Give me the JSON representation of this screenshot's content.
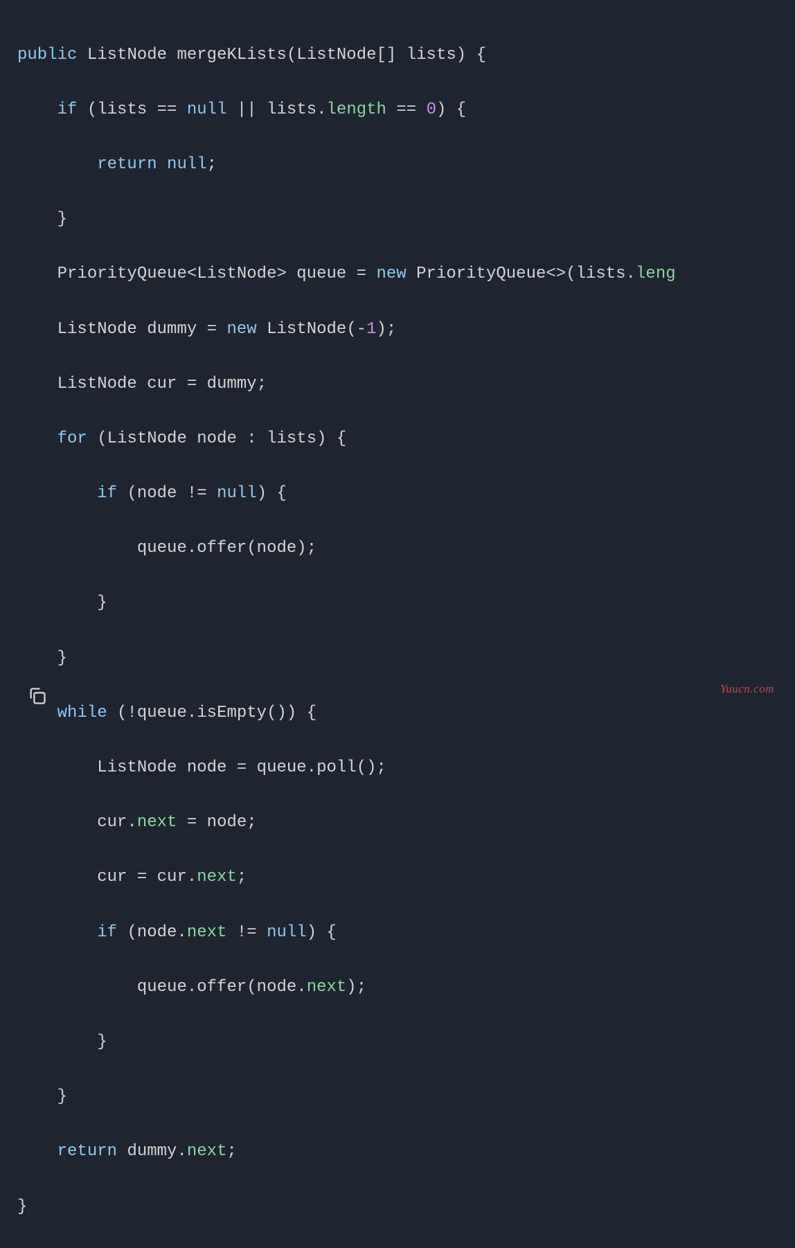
{
  "code": {
    "line1": {
      "kw_public": "public",
      "type1": "ListNode",
      "method": "mergeKLists",
      "paren_open": "(",
      "type2": "ListNode",
      "brackets": "[]",
      "param": "lists",
      "paren_close": ")",
      "brace_open": "{"
    },
    "line2": {
      "kw_if": "if",
      "paren_open": "(",
      "var1": "lists",
      "op_eq1": "==",
      "kw_null1": "null",
      "op_or": "||",
      "var2": "lists",
      "dot": ".",
      "prop": "length",
      "op_eq2": "==",
      "num": "0",
      "paren_close": ")",
      "brace_open": "{"
    },
    "line3": {
      "kw_return": "return",
      "kw_null": "null",
      "semi": ";"
    },
    "line4": {
      "brace_close": "}"
    },
    "line5": {
      "type1": "PriorityQueue",
      "lt": "<",
      "type2": "ListNode",
      "gt": ">",
      "var": "queue",
      "op_assign": "=",
      "kw_new": "new",
      "type3": "PriorityQueue",
      "diamond": "<>",
      "paren_open": "(",
      "var2": "lists",
      "dot": ".",
      "rest": "leng"
    },
    "line6": {
      "type": "ListNode",
      "var": "dummy",
      "op_assign": "=",
      "kw_new": "new",
      "type2": "ListNode",
      "paren_open": "(",
      "op_minus": "-",
      "num": "1",
      "paren_close": ")",
      "semi": ";"
    },
    "line7": {
      "type": "ListNode",
      "var": "cur",
      "op_assign": "=",
      "var2": "dummy",
      "semi": ";"
    },
    "line8": {
      "kw_for": "for",
      "paren_open": "(",
      "type": "ListNode",
      "var": "node",
      "colon": ":",
      "var2": "lists",
      "paren_close": ")",
      "brace_open": "{"
    },
    "line9": {
      "kw_if": "if",
      "paren_open": "(",
      "var": "node",
      "op_neq": "!=",
      "kw_null": "null",
      "paren_close": ")",
      "brace_open": "{"
    },
    "line10": {
      "var": "queue",
      "dot": ".",
      "method": "offer",
      "paren_open": "(",
      "arg": "node",
      "paren_close": ")",
      "semi": ";"
    },
    "line11": {
      "brace_close": "}"
    },
    "line12": {
      "brace_close": "}"
    },
    "line13": {
      "kw_while": "while",
      "paren_open": "(",
      "op_not": "!",
      "var": "queue",
      "dot": ".",
      "method": "isEmpty",
      "parens": "()",
      "paren_close": ")",
      "brace_open": "{"
    },
    "line14": {
      "type": "ListNode",
      "var": "node",
      "op_assign": "=",
      "var2": "queue",
      "dot": ".",
      "method": "poll",
      "parens": "()",
      "semi": ";"
    },
    "line15": {
      "var": "cur",
      "dot": ".",
      "prop": "next",
      "op_assign": "=",
      "var2": "node",
      "semi": ";"
    },
    "line16": {
      "var": "cur",
      "op_assign": "=",
      "var2": "cur",
      "dot": ".",
      "prop": "next",
      "semi": ";"
    },
    "line17": {
      "kw_if": "if",
      "paren_open": "(",
      "var": "node",
      "dot": ".",
      "prop": "next",
      "op_neq": "!=",
      "kw_null": "null",
      "paren_close": ")",
      "brace_open": "{"
    },
    "line18": {
      "var": "queue",
      "dot": ".",
      "method": "offer",
      "paren_open": "(",
      "arg": "node",
      "dot2": ".",
      "prop": "next",
      "paren_close": ")",
      "semi": ";"
    },
    "line19": {
      "brace_close": "}"
    },
    "line20": {
      "brace_close": "}"
    },
    "line21": {
      "kw_return": "return",
      "var": "dummy",
      "dot": ".",
      "prop": "next",
      "semi": ";"
    },
    "line22": {
      "brace_close": "}"
    }
  },
  "watermark": "Yuucn.com"
}
